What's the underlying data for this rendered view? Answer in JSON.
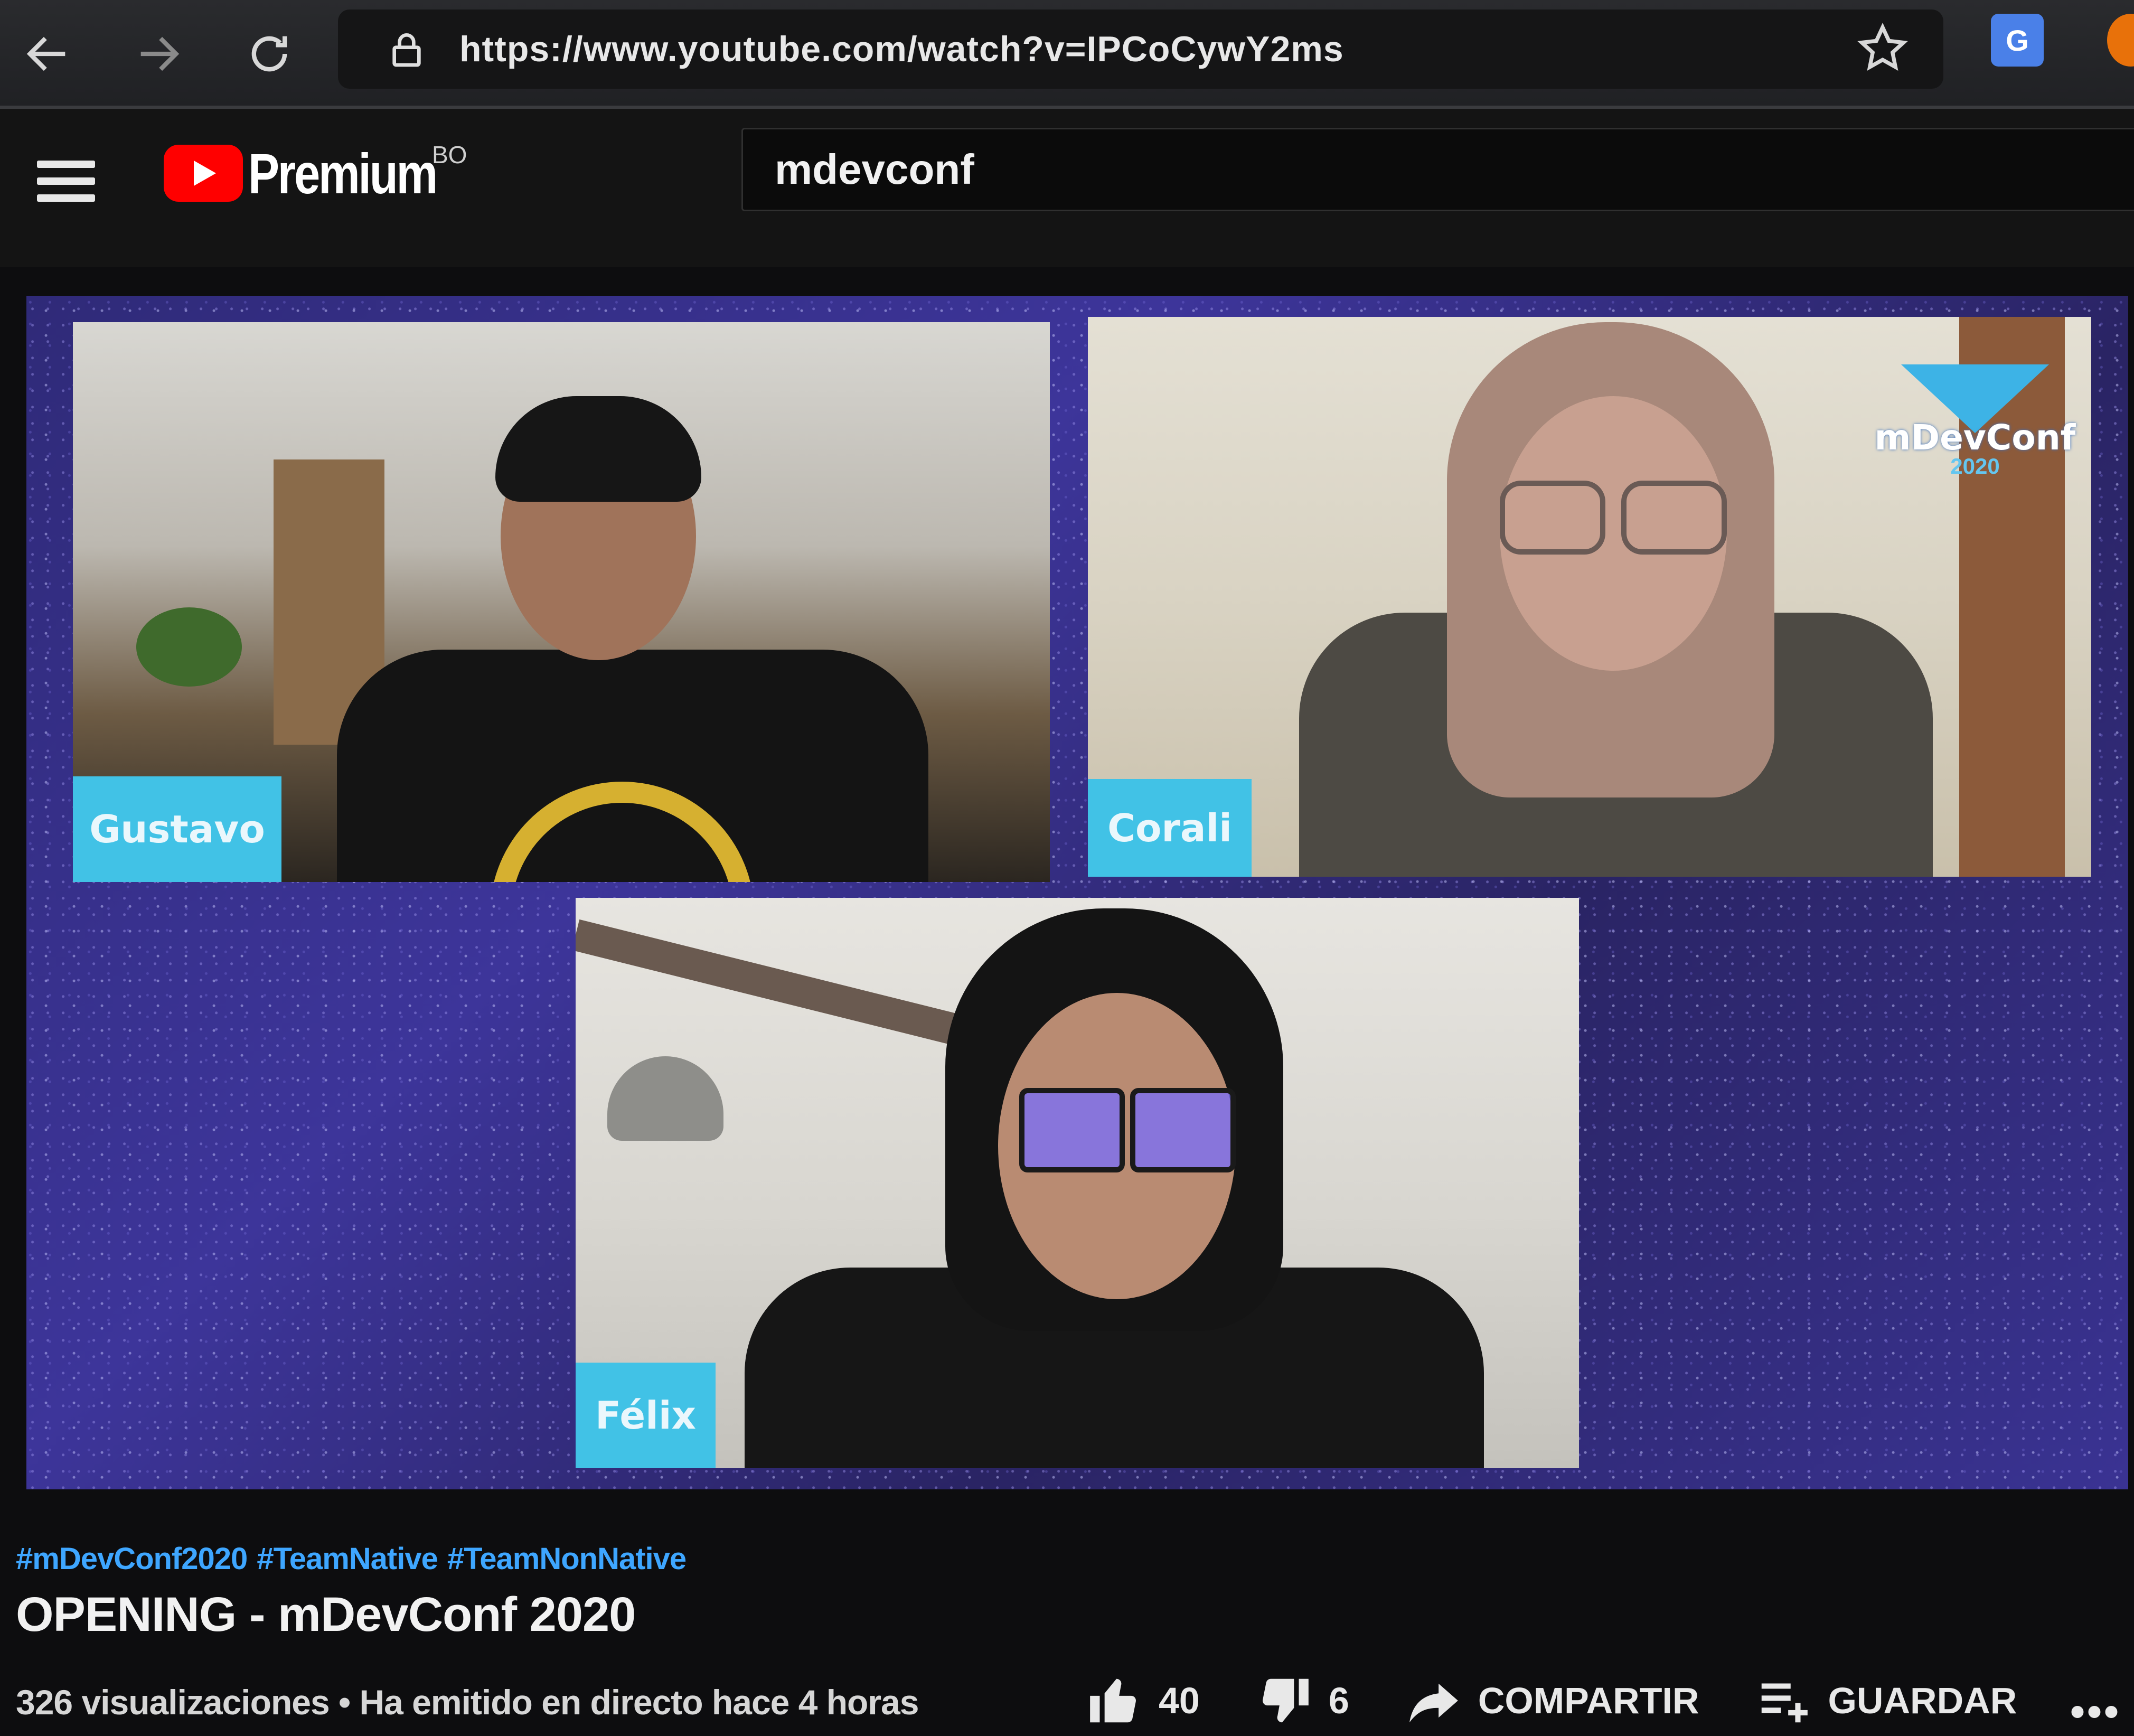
{
  "browser": {
    "url": "https://www.youtube.com/watch?v=IPCoCywY2ms",
    "translate_label": "G"
  },
  "youtube": {
    "logo_text": "Premium",
    "country_code": "BO",
    "search_value": "mdevconf"
  },
  "video": {
    "participants": [
      {
        "name": "Gustavo"
      },
      {
        "name": "Corali"
      },
      {
        "name": "Félix"
      }
    ],
    "overlay_logo": {
      "text": "mDevConf",
      "year": "2020"
    }
  },
  "info": {
    "hashtags": [
      "#mDevConf2020",
      "#TeamNative",
      "#TeamNonNative"
    ],
    "title": "OPENING - mDevConf 2020",
    "meta": "326 visualizaciones • Ha emitido en directo hace 4 horas",
    "likes": "40",
    "dislikes": "6",
    "share_label": "COMPARTIR",
    "save_label": "GUARDAR",
    "more_label": "•••"
  },
  "colors": {
    "brand_red": "#ff0000",
    "link_blue": "#3ea6ff",
    "name_tag": "#41c2e6",
    "video_bg": "#2f2a78"
  }
}
